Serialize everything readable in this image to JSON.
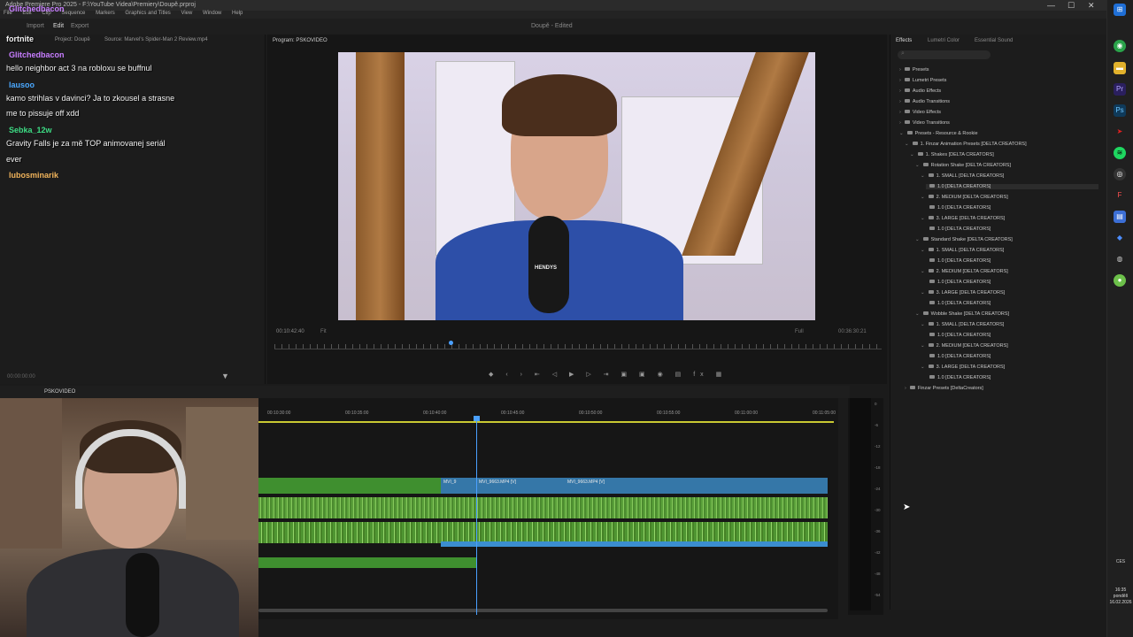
{
  "titlebar": {
    "title": "Adobe Premiere Pro 2025 - F:\\YouTube Videa\\Premiery\\Doupě.prproj",
    "min": "—",
    "max": "☐",
    "close": "✕"
  },
  "menu": [
    "File",
    "Edit",
    "Clip",
    "Sequence",
    "Markers",
    "Graphics and Titles",
    "View",
    "Window",
    "Help"
  ],
  "workspace": {
    "tabs": [
      "Import",
      "Edit",
      "Export"
    ],
    "center_title": "Doupě - Edited"
  },
  "left_panel": {
    "tabs": [
      "Project: Doupě",
      "Source: Marvel's Spider-Man 2 Review.mp4"
    ],
    "footer_time": "00:00:00:00"
  },
  "chat": {
    "overlay_top": "Glitchedbacon",
    "messages": [
      {
        "user": "",
        "text": "fortnite"
      },
      {
        "user": "Glitchedbacon",
        "text": "hello neighbor act 3 na robloxu se buffnul",
        "color": "#c77dff"
      },
      {
        "user": "lausoo",
        "text": "kamo strihlas v davinci? Ja to zkousel a strasne",
        "color": "#4aa8ff"
      },
      {
        "user": "",
        "text": "me to pissuje off xdd"
      },
      {
        "user": "Sebka_12w",
        "text": "Gravity Falls je za mě TOP animovanej seriál",
        "color": "#3ddc84"
      },
      {
        "user": "",
        "text": "ever"
      },
      {
        "user": "lubosminarik",
        "text": "",
        "color": "#f0b35a"
      }
    ]
  },
  "program": {
    "title": "Program: PSKOVIDEO",
    "timecode_left": "00:10:42:40",
    "fit": "Fit",
    "full": "Full",
    "timecode_right": "00:36:30:21",
    "mic_logo": "HENDYS"
  },
  "effects": {
    "tabs": [
      "Effects",
      "Lumetri Color",
      "Essential Sound"
    ],
    "search_placeholder": "",
    "tree": [
      {
        "label": "Presets",
        "depth": 0,
        "arrow": "›"
      },
      {
        "label": "Lumetri Presets",
        "depth": 0,
        "arrow": "›"
      },
      {
        "label": "Audio Effects",
        "depth": 0,
        "arrow": "›"
      },
      {
        "label": "Audio Transitions",
        "depth": 0,
        "arrow": "›"
      },
      {
        "label": "Video Effects",
        "depth": 0,
        "arrow": "›"
      },
      {
        "label": "Video Transitions",
        "depth": 0,
        "arrow": "›"
      },
      {
        "label": "Presets - Resource & Rookie",
        "depth": 0,
        "arrow": "⌄"
      },
      {
        "label": "1. Finzar Animation Presets [DELTA CREATORS]",
        "depth": 1,
        "arrow": "⌄"
      },
      {
        "label": "1. Shakes [DELTA CREATORS]",
        "depth": 2,
        "arrow": "⌄"
      },
      {
        "label": "Rotation Shake [DELTA CREATORS]",
        "depth": 3,
        "arrow": "⌄"
      },
      {
        "label": "1. SMALL [DELTA CREATORS]",
        "depth": 4,
        "arrow": "⌄"
      },
      {
        "label": "1.0 [DELTA CREATORS]",
        "depth": 5,
        "arrow": ""
      },
      {
        "label": "2. MEDIUM [DELTA CREATORS]",
        "depth": 4,
        "arrow": "⌄"
      },
      {
        "label": "1.0 [DELTA CREATORS]",
        "depth": 5,
        "arrow": ""
      },
      {
        "label": "3. LARGE [DELTA CREATORS]",
        "depth": 4,
        "arrow": "⌄"
      },
      {
        "label": "1.0 [DELTA CREATORS]",
        "depth": 5,
        "arrow": ""
      },
      {
        "label": "Standard Shake [DELTA CREATORS]",
        "depth": 3,
        "arrow": "⌄"
      },
      {
        "label": "1. SMALL [DELTA CREATORS]",
        "depth": 4,
        "arrow": "⌄"
      },
      {
        "label": "1.0 [DELTA CREATORS]",
        "depth": 5,
        "arrow": ""
      },
      {
        "label": "2. MEDIUM [DELTA CREATORS]",
        "depth": 4,
        "arrow": "⌄"
      },
      {
        "label": "1.0 [DELTA CREATORS]",
        "depth": 5,
        "arrow": ""
      },
      {
        "label": "3. LARGE [DELTA CREATORS]",
        "depth": 4,
        "arrow": "⌄"
      },
      {
        "label": "1.0 [DELTA CREATORS]",
        "depth": 5,
        "arrow": ""
      },
      {
        "label": "Wobble Shake [DELTA CREATORS]",
        "depth": 3,
        "arrow": "⌄"
      },
      {
        "label": "1. SMALL [DELTA CREATORS]",
        "depth": 4,
        "arrow": "⌄"
      },
      {
        "label": "1.0 [DELTA CREATORS]",
        "depth": 5,
        "arrow": ""
      },
      {
        "label": "2. MEDIUM [DELTA CREATORS]",
        "depth": 4,
        "arrow": "⌄"
      },
      {
        "label": "1.0 [DELTA CREATORS]",
        "depth": 5,
        "arrow": ""
      },
      {
        "label": "3. LARGE [DELTA CREATORS]",
        "depth": 4,
        "arrow": "⌄"
      },
      {
        "label": "1.0 [DELTA CREATORS]",
        "depth": 5,
        "arrow": ""
      },
      {
        "label": "Finzar Presets [DeltaCreators]",
        "depth": 1,
        "arrow": "›"
      }
    ]
  },
  "sequence": {
    "tab": "PSKOVIDEO",
    "ruler": [
      "00:10:30:00",
      "00:10:35:00",
      "00:10:40:00",
      "00:10:45:00",
      "00:10:50:00",
      "00:10:55:00",
      "00:11:00:00",
      "00:11:05:00"
    ],
    "clips": [
      "MVI_9",
      "MVI_9663.MP4 [V]",
      "MVI_9663.MP4 [V]"
    ]
  },
  "meters": {
    "ticks": [
      "0",
      "-6",
      "-12",
      "-18",
      "-24",
      "-30",
      "-36",
      "-42",
      "-48",
      "-54"
    ]
  },
  "taskbar": {
    "lang": "CES",
    "time": "16:35",
    "day": "pondělí",
    "date": "16.02.2026"
  }
}
